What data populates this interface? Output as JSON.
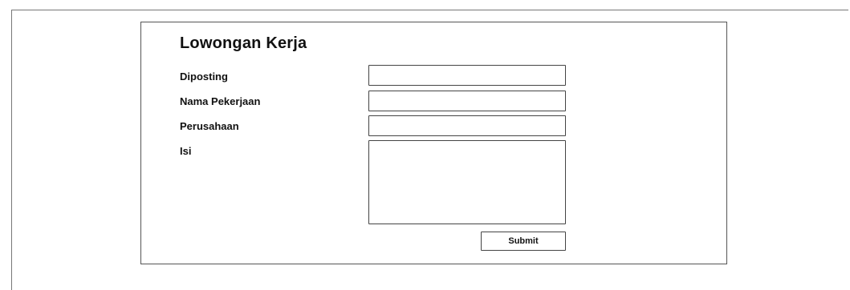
{
  "form": {
    "title": "Lowongan Kerja",
    "fields": {
      "diposting": {
        "label": "Diposting",
        "value": ""
      },
      "nama_pekerjaan": {
        "label": "Nama Pekerjaan",
        "value": ""
      },
      "perusahaan": {
        "label": "Perusahaan",
        "value": ""
      },
      "isi": {
        "label": "Isi",
        "value": ""
      }
    },
    "submit_label": "Submit"
  }
}
